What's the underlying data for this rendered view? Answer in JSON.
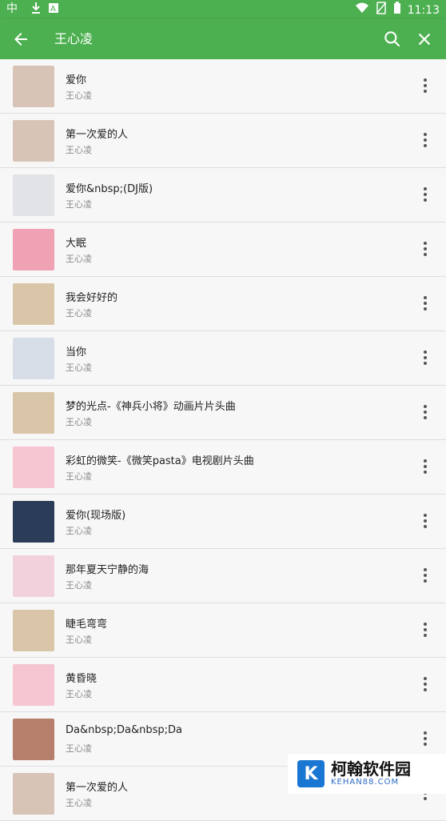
{
  "statusbar": {
    "time": "11:13",
    "left_icons": [
      "app-icon",
      "download-icon",
      "notification-icon"
    ],
    "right_icons": [
      "wifi-icon",
      "no-sim-icon",
      "battery-icon"
    ]
  },
  "toolbar": {
    "title": "王心凌",
    "back_icon": "arrow-back-icon",
    "search_icon": "search-icon",
    "close_icon": "close-icon"
  },
  "colors": {
    "primary": "#4caf50",
    "background": "#f7f7f7",
    "divider": "#dedede"
  },
  "songs": [
    {
      "title": "爱你",
      "artist": "王心凌",
      "thumb": "#d7c4b7"
    },
    {
      "title": "第一次爱的人",
      "artist": "王心凌",
      "thumb": "#d7c4b7"
    },
    {
      "title": "爱你&nbsp;(DJ版)",
      "artist": "王心凌",
      "thumb": "#e1e3e6"
    },
    {
      "title": "大眠",
      "artist": "王心凌",
      "thumb": "#f0a2b5"
    },
    {
      "title": "我会好好的",
      "artist": "王心凌",
      "thumb": "#d9c6a8"
    },
    {
      "title": "当你",
      "artist": "王心凌",
      "thumb": "#d8dee7"
    },
    {
      "title": "梦的光点-《神兵小将》动画片片头曲",
      "artist": "王心凌",
      "thumb": "#d9c6a8"
    },
    {
      "title": "彩虹的微笑-《微笑pasta》电视剧片头曲",
      "artist": "王心凌",
      "thumb": "#f5c5d1"
    },
    {
      "title": "爱你(现场版)",
      "artist": "王心凌",
      "thumb": "#2b3c58"
    },
    {
      "title": "那年夏天宁静的海",
      "artist": "王心凌",
      "thumb": "#f3d1dc"
    },
    {
      "title": "睫毛弯弯",
      "artist": "王心凌",
      "thumb": "#d9c6a8"
    },
    {
      "title": "黄昏晓",
      "artist": "王心凌",
      "thumb": "#f5c5d1"
    },
    {
      "title": "Da&nbsp;Da&nbsp;Da",
      "artist": "王心凌",
      "thumb": "#b67f6c"
    },
    {
      "title": "第一次爱的人",
      "artist": "王心凌",
      "thumb": "#d7c4b7"
    }
  ],
  "watermark": {
    "title": "柯翰软件园",
    "subtitle": "KEHAN88.COM",
    "logo_letter": "K"
  }
}
